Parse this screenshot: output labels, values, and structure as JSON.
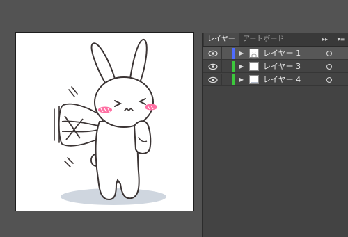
{
  "panel": {
    "tabs": [
      {
        "label": "レイヤー",
        "active": true
      },
      {
        "label": "アートボード",
        "active": false
      }
    ],
    "collapse_icon": "double-chevron-right-icon",
    "menu_icon": "panel-menu-icon"
  },
  "layers": [
    {
      "name": "レイヤー 1",
      "color": "#4f6cff",
      "selected": true,
      "visible": true
    },
    {
      "name": "レイヤー 3",
      "color": "#3cc83c",
      "selected": false,
      "visible": true
    },
    {
      "name": "レイヤー 4",
      "color": "#3cc83c",
      "selected": false,
      "visible": true
    }
  ],
  "colors": {
    "workspace": "#535353",
    "panel": "#434343",
    "selected_row": "#575757",
    "blush": "#ff6fa3",
    "shadow": "#cfd6df"
  }
}
